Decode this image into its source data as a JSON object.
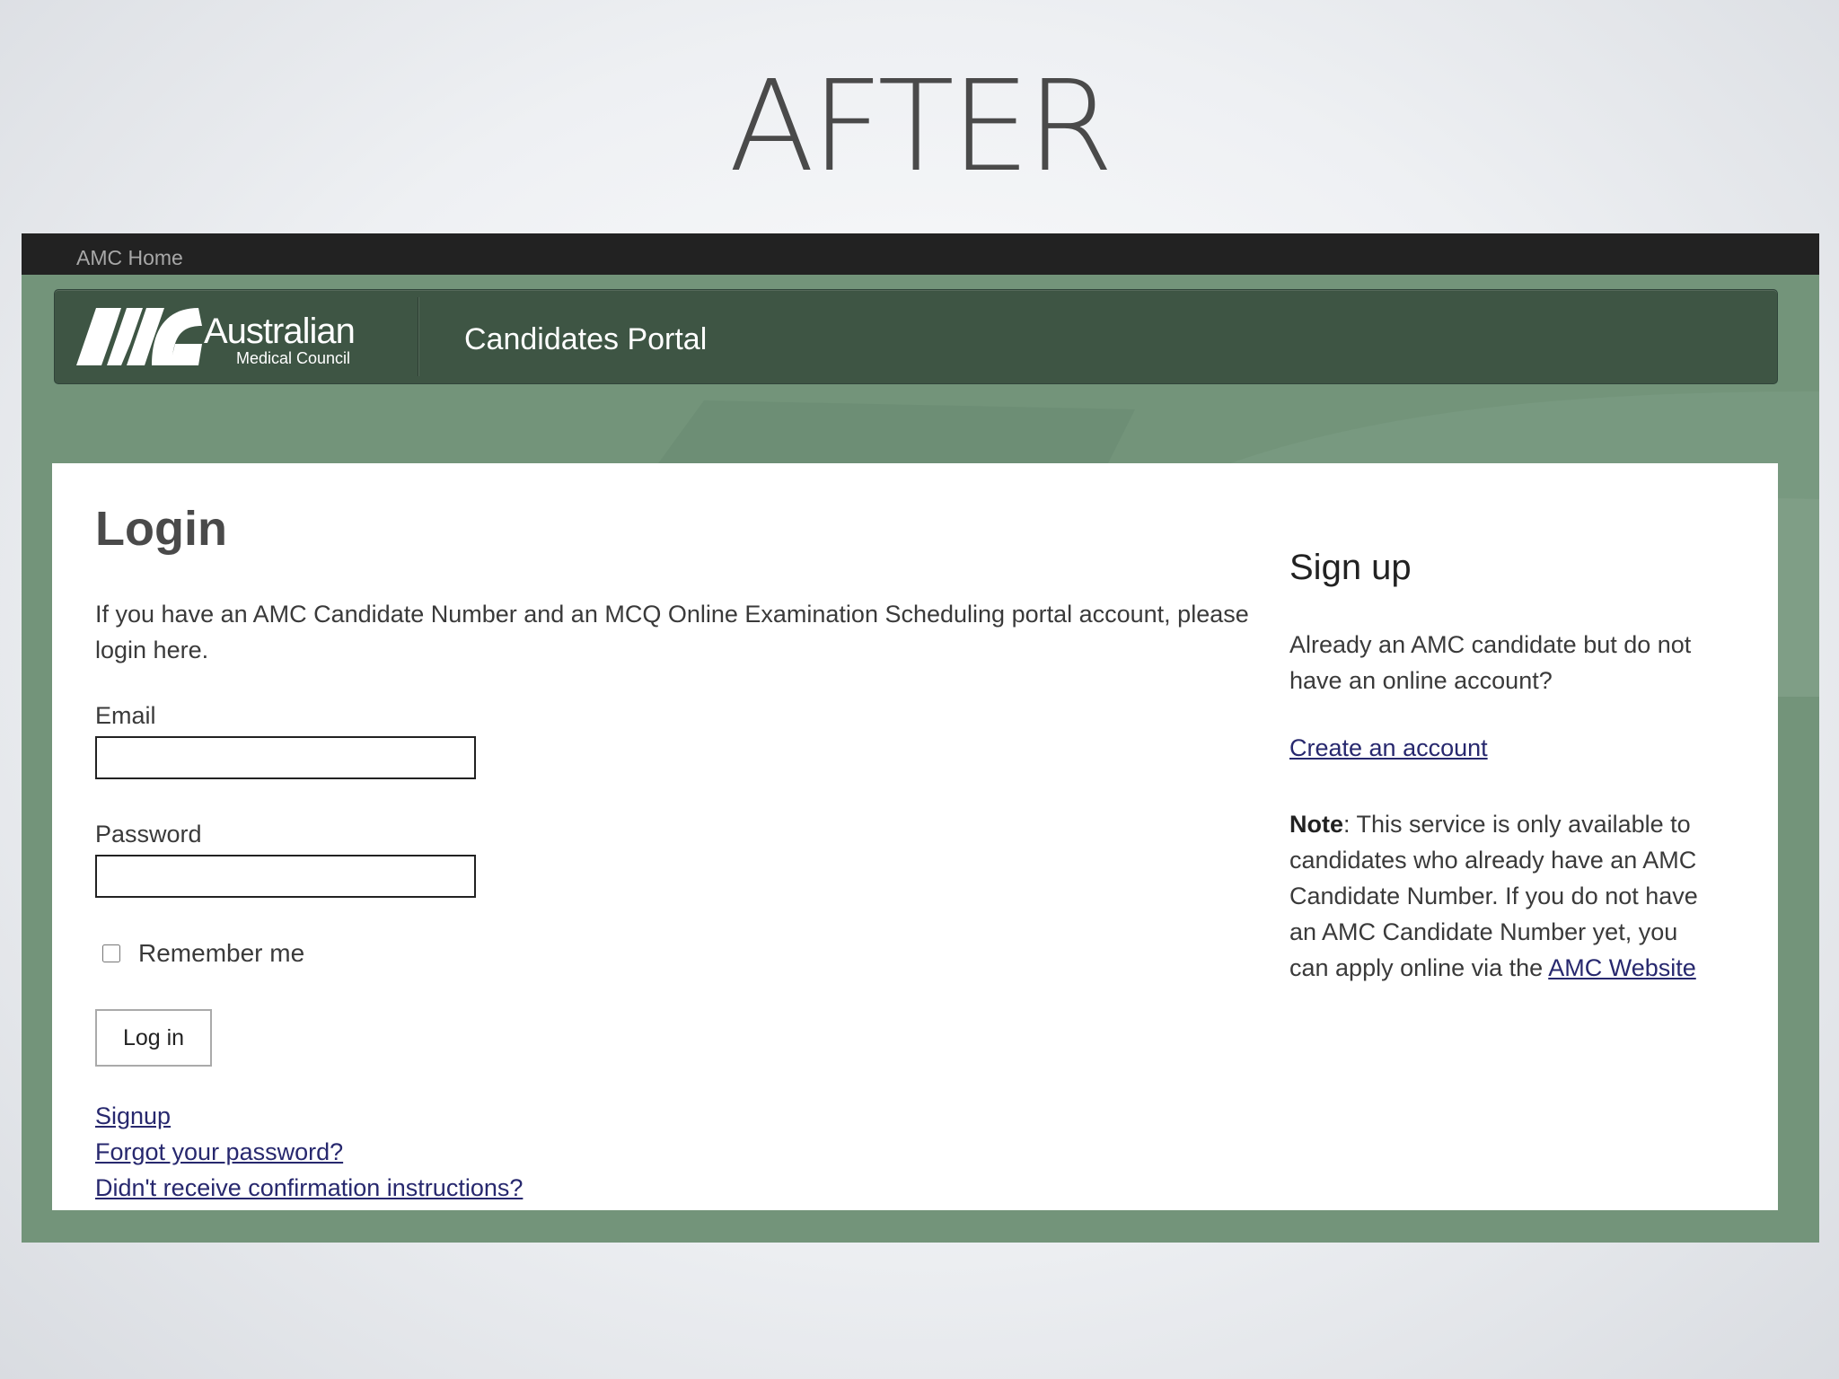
{
  "slide": {
    "title": "AFTER"
  },
  "topbar": {
    "home_link": "AMC Home"
  },
  "header": {
    "logo_word": "Australian",
    "logo_sub": "Medical Council",
    "portal_name": "Candidates Portal"
  },
  "login": {
    "title": "Login",
    "intro": "If you have an AMC Candidate Number and an MCQ Online Examination Scheduling portal account, please login here.",
    "email_label": "Email",
    "email_value": "",
    "password_label": "Password",
    "password_value": "",
    "remember_label": "Remember me",
    "remember_checked": false,
    "button_label": "Log in",
    "links": {
      "signup": "Signup",
      "forgot": "Forgot your password?",
      "confirm": "Didn't receive confirmation instructions?"
    }
  },
  "signup": {
    "title": "Sign up",
    "question": "Already an AMC candidate but do not have an online account?",
    "create_link": "Create an account",
    "note_label": "Note",
    "note_text": ": This service is only available to candidates who already have an AMC Candidate Number. If you do not have an AMC Candidate Number yet, you can apply online via the ",
    "note_link": "AMC Website"
  },
  "colors": {
    "topbar": "#222222",
    "header": "#3e5544",
    "page_green": "#73947a",
    "link": "#27286e"
  }
}
